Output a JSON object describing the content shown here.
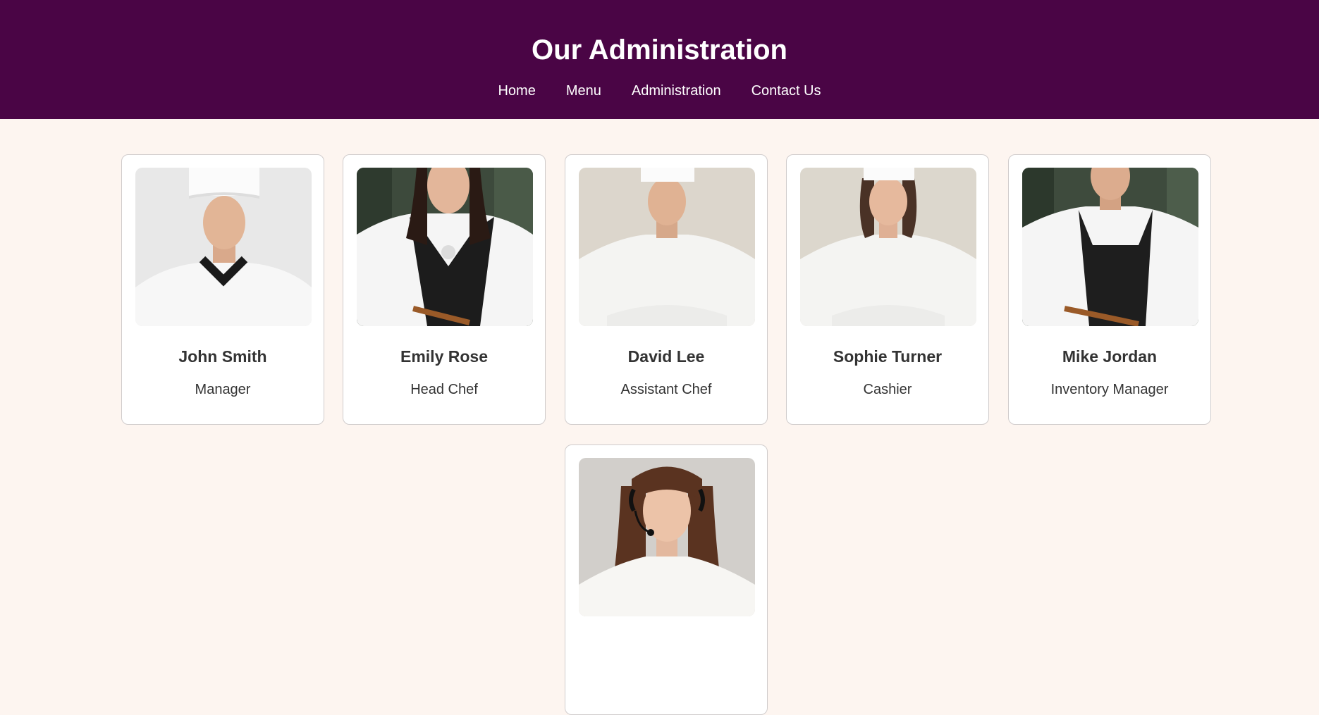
{
  "header": {
    "title": "Our Administration",
    "nav": [
      "Home",
      "Menu",
      "Administration",
      "Contact Us"
    ]
  },
  "staff": [
    {
      "name": "John Smith",
      "role": "Manager",
      "photo": "chef-portrait-man-hat"
    },
    {
      "name": "Emily Rose",
      "role": "Head Chef",
      "photo": "chef-woman-apron"
    },
    {
      "name": "David Lee",
      "role": "Assistant Chef",
      "photo": "chef-man-arms-crossed"
    },
    {
      "name": "Sophie Turner",
      "role": "Cashier",
      "photo": "chef-woman-arms-crossed"
    },
    {
      "name": "Mike Jordan",
      "role": "Inventory Manager",
      "photo": "chef-man-apron"
    },
    {
      "name": "",
      "role": "",
      "photo": "woman-headset"
    }
  ],
  "colors": {
    "header_bg": "#4a0545",
    "page_bg": "#fdf5f0",
    "card_bg": "#ffffff"
  }
}
